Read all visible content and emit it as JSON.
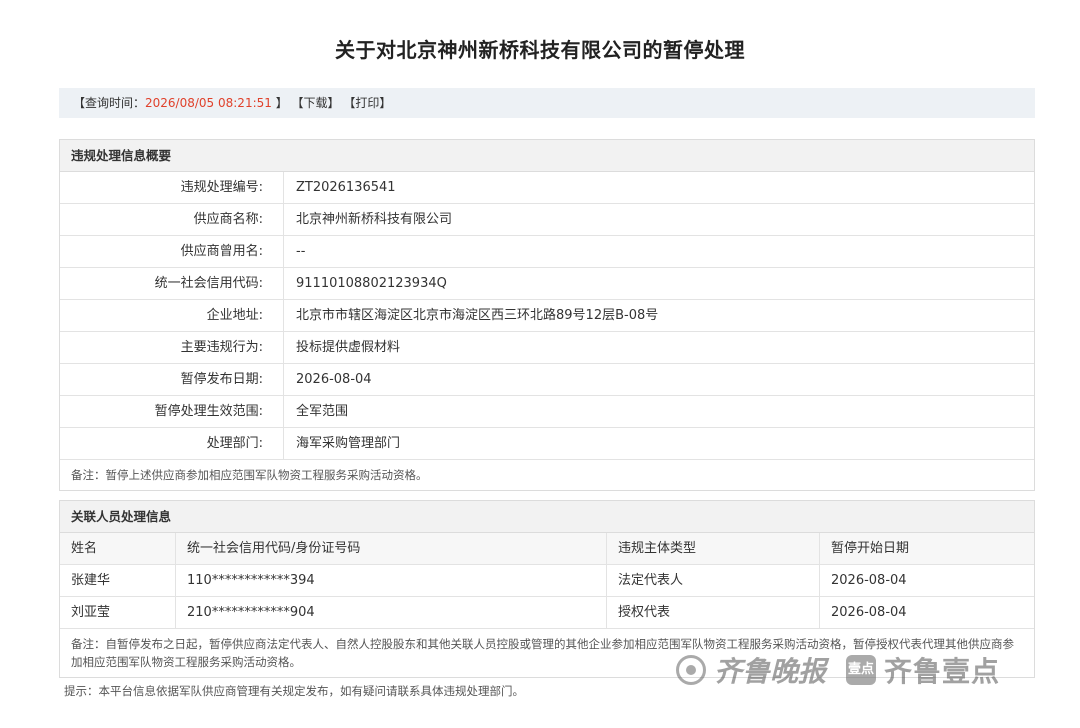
{
  "page": {
    "title": "关于对北京神州新桥科技有限公司的暂停处理"
  },
  "query_bar": {
    "prefix": "【查询时间：",
    "time": "2026/08/05 08:21:51",
    "suffix": " 】",
    "download": "【下载】",
    "print": "【打印】"
  },
  "summary": {
    "heading": "违规处理信息概要",
    "rows": [
      {
        "label": "违规处理编号:",
        "value": "ZT2026136541"
      },
      {
        "label": "供应商名称:",
        "value": "北京神州新桥科技有限公司"
      },
      {
        "label": "供应商曾用名:",
        "value": "--"
      },
      {
        "label": "统一社会信用代码:",
        "value": "91110108802123934Q"
      },
      {
        "label": "企业地址:",
        "value": "北京市市辖区海淀区北京市海淀区西三环北路89号12层B-08号"
      },
      {
        "label": "主要违规行为:",
        "value": "投标提供虚假材料"
      },
      {
        "label": "暂停发布日期:",
        "value": "2026-08-04"
      },
      {
        "label": "暂停处理生效范围:",
        "value": "全军范围"
      },
      {
        "label": "处理部门:",
        "value": "海军采购管理部门"
      }
    ],
    "note": "备注：暂停上述供应商参加相应范围军队物资工程服务采购活动资格。"
  },
  "related": {
    "heading": "关联人员处理信息",
    "columns": [
      "姓名",
      "统一社会信用代码/身份证号码",
      "违规主体类型",
      "暂停开始日期"
    ],
    "rows": [
      [
        "张建华",
        "110************394",
        "法定代表人",
        "2026-08-04"
      ],
      [
        "刘亚莹",
        "210************904",
        "授权代表",
        "2026-08-04"
      ]
    ],
    "note": "备注：自暂停发布之日起，暂停供应商法定代表人、自然人控股股东和其他关联人员控股或管理的其他企业参加相应范围军队物资工程服务采购活动资格，暂停授权代表代理其他供应商参加相应范围军队物资工程服务采购活动资格。"
  },
  "footer_tip": "提示：本平台信息依据军队供应商管理有关规定发布，如有疑问请联系具体违规处理部门。",
  "watermark": {
    "text1": "齐鲁晚报",
    "badge": "壹点",
    "text2": "齐鲁壹点"
  }
}
